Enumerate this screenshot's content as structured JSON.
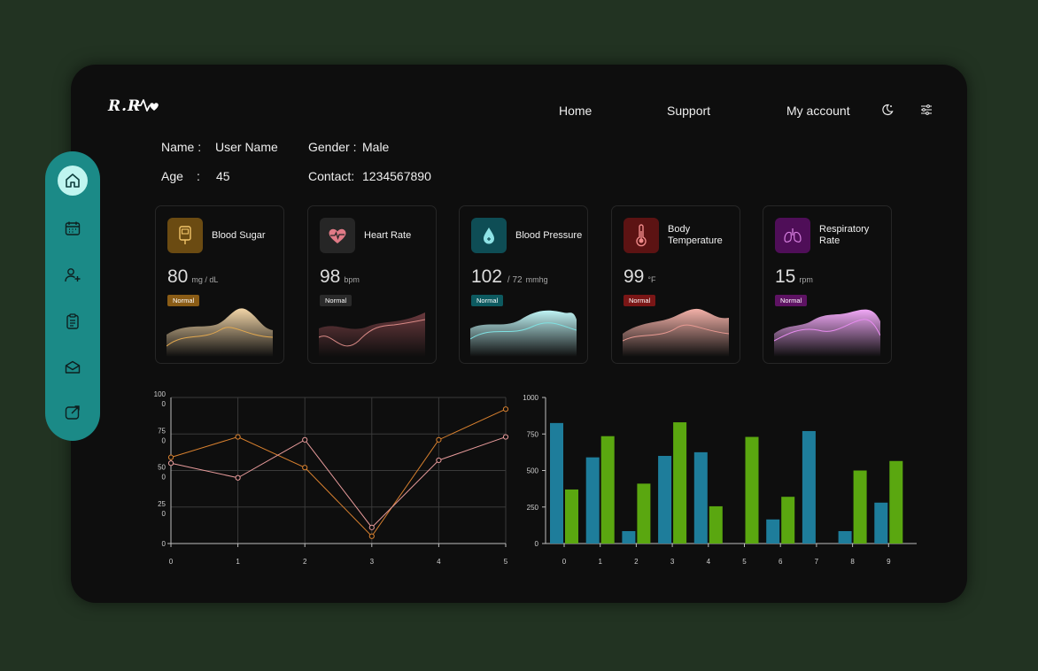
{
  "header": {
    "logo_text": "R.R",
    "nav": {
      "home": "Home",
      "support": "Support",
      "account": "My account"
    },
    "icons": {
      "theme": "moon-icon",
      "settings": "sliders-icon"
    }
  },
  "patient": {
    "name_label": "Name :",
    "name_value": "User Name",
    "gender_label": "Gender :",
    "gender_value": "Male",
    "age_label": "Age",
    "age_sep": ":",
    "age_value": "45",
    "contact_label": "Contact:",
    "contact_value": "1234567890"
  },
  "sidebar": {
    "items": [
      {
        "icon": "home-icon",
        "active": true
      },
      {
        "icon": "calendar-icon"
      },
      {
        "icon": "add-user-icon"
      },
      {
        "icon": "clipboard-icon"
      },
      {
        "icon": "mail-icon"
      },
      {
        "icon": "share-icon"
      }
    ],
    "accent": "#1b8a87",
    "active_bg": "#bff5ef"
  },
  "vitals": [
    {
      "title": "Blood Sugar",
      "value": "80",
      "unit": "mg / dL",
      "status": "Normal",
      "color": "#e3a94f",
      "icon_bg": "#6b4b12",
      "icon": "glucose-meter-icon"
    },
    {
      "title": "Heart Rate",
      "value": "98",
      "unit": "bpm",
      "status": "Normal",
      "color": "#d98a86",
      "icon_bg": "#262626",
      "icon": "heart-pulse-icon"
    },
    {
      "title": "Blood Pressure",
      "value": "102",
      "value_sub": "/ 72",
      "unit": "mmhg",
      "status": "Normal",
      "color": "#7fe1e2",
      "icon_bg": "#0e4d55",
      "icon": "blood-drop-icon"
    },
    {
      "title": "Body Temperature",
      "value": "99",
      "unit": "°F",
      "status": "Normal",
      "color": "#e99a92",
      "icon_bg": "#5c1313",
      "icon": "thermometer-icon"
    },
    {
      "title": "Respiratory Rate",
      "value": "15",
      "unit": "rpm",
      "status": "Normal",
      "color": "#e88cf0",
      "icon_bg": "#4f0e58",
      "icon": "lungs-icon"
    }
  ],
  "badge_colors": [
    "#8a5c16",
    "#2a2a2a",
    "#0d5a60",
    "#7a1616",
    "#5e1363"
  ],
  "chart_data": [
    {
      "type": "line",
      "x": [
        0,
        1,
        2,
        3,
        4,
        5
      ],
      "xtick_labels": [
        "0",
        "1",
        "2",
        "3",
        "4",
        "5"
      ],
      "ytick_labels": [
        {
          "main": "0",
          "tail": ""
        },
        {
          "main": "25",
          "tail": "0"
        },
        {
          "main": "50",
          "tail": "0"
        },
        {
          "main": "75",
          "tail": "0"
        },
        {
          "main": "100",
          "tail": "0"
        }
      ],
      "ylim": [
        0,
        100
      ],
      "series": [
        {
          "values": [
            59,
            73,
            52,
            5,
            71,
            92
          ],
          "color": "#d9812f"
        },
        {
          "values": [
            55,
            45,
            71,
            11,
            57,
            73
          ],
          "color": "#e89b9b"
        }
      ],
      "grid": true
    },
    {
      "type": "bar",
      "categories": [
        "0",
        "1",
        "2",
        "3",
        "4",
        "5",
        "6",
        "7",
        "8",
        "9"
      ],
      "ytick_labels": [
        "0",
        "250",
        "500",
        "750",
        "1000"
      ],
      "ylim": [
        0,
        1000
      ],
      "series": [
        {
          "values": [
            825,
            590,
            85,
            600,
            625,
            0,
            165,
            770,
            85,
            280
          ],
          "color": "#1e7d9b"
        },
        {
          "values": [
            370,
            735,
            410,
            830,
            255,
            730,
            320,
            0,
            500,
            565
          ],
          "color": "#5aa710"
        }
      ]
    }
  ]
}
